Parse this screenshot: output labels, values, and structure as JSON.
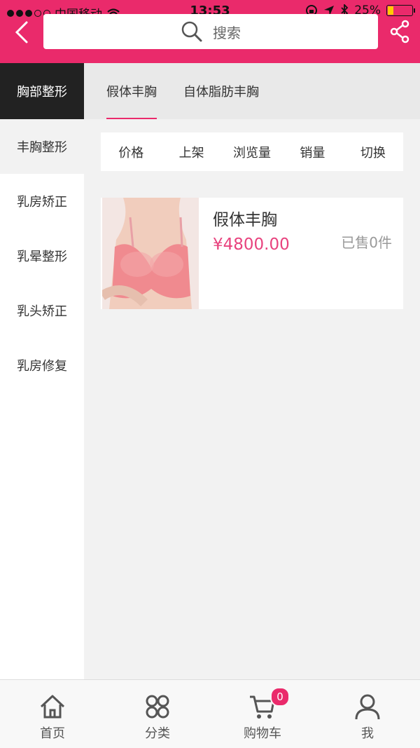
{
  "status_bar": {
    "carrier": "中国移动",
    "time": "13:53",
    "battery": "25%",
    "battery_level": 0.25
  },
  "header": {
    "search_placeholder": "搜索"
  },
  "left_menu": {
    "header": "胸部整形",
    "items": [
      {
        "label": "丰胸整形",
        "active": true
      },
      {
        "label": "乳房矫正"
      },
      {
        "label": "乳晕整形"
      },
      {
        "label": "乳头矫正"
      },
      {
        "label": "乳房修复"
      }
    ]
  },
  "tabs": [
    {
      "label": "假体丰胸",
      "active": true
    },
    {
      "label": "自体脂肪丰胸"
    }
  ],
  "sort_options": [
    "价格",
    "上架",
    "浏览量",
    "销量",
    "切换"
  ],
  "products": [
    {
      "name": "假体丰胸",
      "price": "¥4800.00",
      "sold": "已售0件"
    }
  ],
  "bottom_nav": {
    "home": "首页",
    "category": "分类",
    "cart": "购物车",
    "cart_count": "0",
    "me": "我"
  },
  "colors": {
    "accent": "#ea2a6b",
    "price": "#e8437e"
  }
}
